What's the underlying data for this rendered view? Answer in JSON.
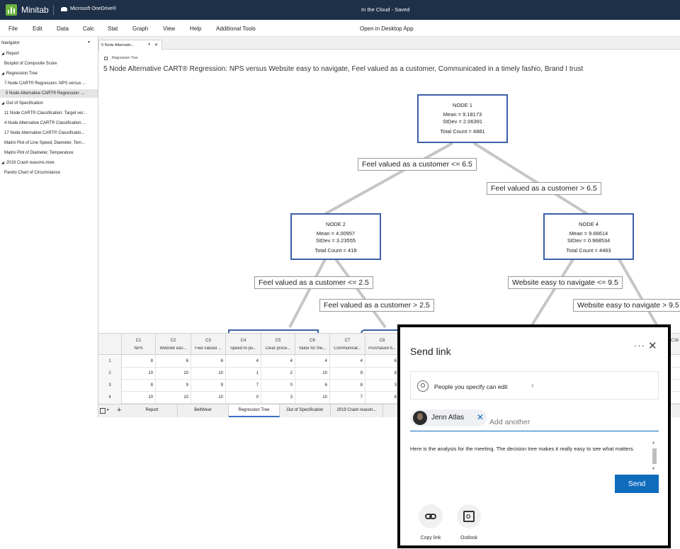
{
  "app": {
    "name": "Minitab",
    "storage": "Microsoft OneDrive®",
    "cloud_status": "In the Cloud  -  Saved"
  },
  "menu": {
    "items": [
      "File",
      "Edit",
      "Data",
      "Calc",
      "Stat",
      "Graph",
      "View",
      "Help",
      "Additional Tools"
    ],
    "open_desktop": "Open in Desktop App"
  },
  "navigator": {
    "title": "Navigator",
    "rows": [
      {
        "label": "Report",
        "group": true
      },
      {
        "label": "Boxplot of Composite Score",
        "group": false
      },
      {
        "label": "Regression Tree",
        "group": true
      },
      {
        "label": "7 Node CART® Regression: NPS versus ...",
        "group": false
      },
      {
        "label": "5 Node Alternative CART® Regression: ...",
        "group": false,
        "selected": true
      },
      {
        "label": "Out of Specification",
        "group": true
      },
      {
        "label": "11 Node CART® Classification: Target ver...",
        "group": false
      },
      {
        "label": "4 Node Alternative CART® Classification:...",
        "group": false
      },
      {
        "label": "17 Node Alternative CART® Classificatio...",
        "group": false
      },
      {
        "label": "Matrix Plot of Line Speed, Diameter, Tem...",
        "group": false
      },
      {
        "label": "Matrix Plot of Diameter, Temperature",
        "group": false
      },
      {
        "label": "2019 Crash reasons.mwx",
        "group": true
      },
      {
        "label": "Pareto Chart of Circumstance",
        "group": false
      }
    ]
  },
  "doc_tab": {
    "label": "5 Node Alternativ..."
  },
  "breadcrumb": "Regression Tree",
  "output_title": "5 Node Alternative CART® Regression: NPS versus Website easy to navigate, Feel valued as a customer, Communicated in a timely fashio, Brand I trust",
  "tree": {
    "nodes": [
      {
        "title": "NODE 1",
        "mean": "Mean = 9.18173",
        "stdev": "StDev = 2.06391",
        "count": "Total Count = 4881"
      },
      {
        "title": "NODE 2",
        "mean": "Mean = 4.00957",
        "stdev": "StDev = 3.23555",
        "count": "Total Count = 418"
      },
      {
        "title": "NODE 4",
        "mean": "Mean = 9.66614",
        "stdev": "StDev = 0.968534",
        "count": "Total Count = 4463"
      }
    ],
    "splits": [
      "Feel valued as a customer <= 6.5",
      "Feel valued as a customer > 6.5",
      "Feel valued as a customer <= 2.5",
      "Feel valued as a customer > 2.5",
      "Website easy to navigate <= 9.5",
      "Website easy to navigate > 9.5"
    ]
  },
  "worksheet": {
    "columns": [
      {
        "id": "C1",
        "name": "NPS"
      },
      {
        "id": "C2",
        "name": "Website eas..."
      },
      {
        "id": "C3",
        "name": "Feel valued ..."
      },
      {
        "id": "C4",
        "name": "Speed to pu..."
      },
      {
        "id": "C5",
        "name": "Clear proce..."
      },
      {
        "id": "C6",
        "name": "Value for the..."
      },
      {
        "id": "C7",
        "name": "Communicat..."
      },
      {
        "id": "C8",
        "name": "Purchased b..."
      }
    ],
    "extra_col": "C16",
    "rows": [
      {
        "num": "1",
        "cells": [
          "8",
          "6",
          "6",
          "4",
          "4",
          "4",
          "4",
          "6"
        ]
      },
      {
        "num": "2",
        "cells": [
          "10",
          "10",
          "10",
          "1",
          "2",
          "10",
          "9",
          "8"
        ]
      },
      {
        "num": "3",
        "cells": [
          "8",
          "9",
          "9",
          "7",
          "0",
          "6",
          "8",
          "3"
        ]
      },
      {
        "num": "4",
        "cells": [
          "10",
          "10",
          "10",
          "0",
          "3",
          "10",
          "7",
          "6"
        ]
      }
    ]
  },
  "sheet_tabs": [
    {
      "label": "Report",
      "active": false
    },
    {
      "label": "BeltWear",
      "active": false
    },
    {
      "label": "Regression Tree",
      "active": true
    },
    {
      "label": "Out of Specification",
      "active": false
    },
    {
      "label": "2019 Crash reason...",
      "active": false
    }
  ],
  "dialog": {
    "title": "Send link",
    "more": "···",
    "permission": "People you specify can edit",
    "recipient": "Jenn Atlas",
    "add_placeholder": "Add another",
    "message": "Here is the analysis for the meeting.  The decision tree makes it really easy to see what matters.",
    "send": "Send",
    "options": [
      {
        "label": "Copy link",
        "icon": "link-icon"
      },
      {
        "label": "Outlook",
        "icon": "outlook-icon"
      }
    ]
  },
  "colors": {
    "topbar": "#1e3048",
    "node_border": "#3c5fa8",
    "accent": "#0f6cbd"
  }
}
